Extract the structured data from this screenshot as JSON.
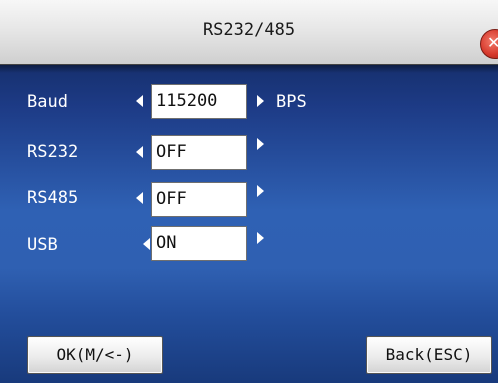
{
  "window": {
    "title": "RS232/485"
  },
  "icons": {
    "close": "close-x-icon",
    "decrease": "triangle-left-icon",
    "increase": "triangle-right-icon"
  },
  "colors": {
    "title_bar": "#e7e7e7",
    "background": "#2f61b4",
    "close_button": "#d6392c"
  },
  "settings": [
    {
      "label": "Baud",
      "value": "115200",
      "unit": "BPS"
    },
    {
      "label": "RS232",
      "value": "OFF"
    },
    {
      "label": "RS485",
      "value": "OFF"
    },
    {
      "label": "USB",
      "value": "ON"
    }
  ],
  "buttons": {
    "ok": "OK(M/<-)",
    "back": "Back(ESC)"
  }
}
